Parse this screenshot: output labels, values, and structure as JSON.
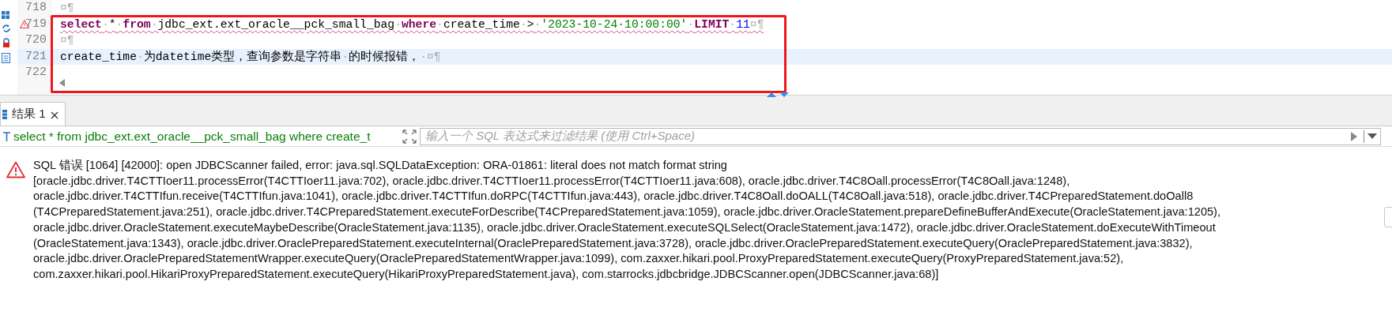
{
  "editor": {
    "lines": [
      {
        "number": "718",
        "warning": false,
        "current": false,
        "squiggle": false,
        "tokens": [
          {
            "text": "¤¶",
            "kind": "mark"
          }
        ]
      },
      {
        "number": "719",
        "warning": true,
        "current": false,
        "squiggle": true,
        "tokens": [
          {
            "text": "select",
            "kind": "keyword"
          },
          {
            "text": "·",
            "kind": "mark"
          },
          {
            "text": "*",
            "kind": "plain"
          },
          {
            "text": "·",
            "kind": "mark"
          },
          {
            "text": "from",
            "kind": "keyword"
          },
          {
            "text": "·",
            "kind": "mark"
          },
          {
            "text": "jdbc_ext.ext_oracle__pck_small_bag",
            "kind": "plain"
          },
          {
            "text": "·",
            "kind": "mark"
          },
          {
            "text": "where",
            "kind": "keyword"
          },
          {
            "text": "·",
            "kind": "mark"
          },
          {
            "text": "create_time",
            "kind": "plain"
          },
          {
            "text": "·",
            "kind": "mark"
          },
          {
            "text": ">",
            "kind": "plain"
          },
          {
            "text": "·",
            "kind": "mark"
          },
          {
            "text": "'2023-10-24·10:00:00'",
            "kind": "string"
          },
          {
            "text": "·",
            "kind": "mark"
          },
          {
            "text": "LIMIT",
            "kind": "keyword"
          },
          {
            "text": "·",
            "kind": "mark"
          },
          {
            "text": "11",
            "kind": "number"
          },
          {
            "text": "¤¶",
            "kind": "mark"
          }
        ]
      },
      {
        "number": "720",
        "warning": false,
        "current": false,
        "squiggle": false,
        "tokens": [
          {
            "text": "¤¶",
            "kind": "mark"
          }
        ]
      },
      {
        "number": "721",
        "warning": false,
        "current": true,
        "squiggle": false,
        "tokens": [
          {
            "text": "create_time",
            "kind": "plain"
          },
          {
            "text": "·",
            "kind": "mark"
          },
          {
            "text": "为datetime类型，查询参数是字符串",
            "kind": "plain"
          },
          {
            "text": "·",
            "kind": "mark"
          },
          {
            "text": "的时候报错，",
            "kind": "plain"
          },
          {
            "text": "·¤¶",
            "kind": "mark"
          }
        ]
      },
      {
        "number": "722",
        "warning": false,
        "current": false,
        "squiggle": false
      }
    ]
  },
  "results": {
    "tabs": [
      {
        "label": "结果 1",
        "selected": true,
        "closable": true
      }
    ],
    "query": "select * from jdbc_ext.ext_oracle__pck_small_bag where create_t",
    "filter": {
      "placeholder": "输入一个 SQL 表达式来过滤结果 (使用 Ctrl+Space)"
    },
    "error_lines": [
      "SQL 错误 [1064] [42000]: open JDBCScanner failed, error: java.sql.SQLDataException: ORA-01861: literal does not match format string",
      "[oracle.jdbc.driver.T4CTTIoer11.processError(T4CTTIoer11.java:702), oracle.jdbc.driver.T4CTTIoer11.processError(T4CTTIoer11.java:608), oracle.jdbc.driver.T4C8Oall.processError(T4C8Oall.java:1248),",
      "oracle.jdbc.driver.T4CTTIfun.receive(T4CTTIfun.java:1041), oracle.jdbc.driver.T4CTTIfun.doRPC(T4CTTIfun.java:443), oracle.jdbc.driver.T4C8Oall.doOALL(T4C8Oall.java:518), oracle.jdbc.driver.T4CPreparedStatement.doOall8",
      "(T4CPreparedStatement.java:251), oracle.jdbc.driver.T4CPreparedStatement.executeForDescribe(T4CPreparedStatement.java:1059), oracle.jdbc.driver.OracleStatement.prepareDefineBufferAndExecute(OracleStatement.java:1205),",
      "oracle.jdbc.driver.OracleStatement.executeMaybeDescribe(OracleStatement.java:1135), oracle.jdbc.driver.OracleStatement.executeSQLSelect(OracleStatement.java:1472), oracle.jdbc.driver.OracleStatement.doExecuteWithTimeout",
      "(OracleStatement.java:1343), oracle.jdbc.driver.OraclePreparedStatement.executeInternal(OraclePreparedStatement.java:3728), oracle.jdbc.driver.OraclePreparedStatement.executeQuery(OraclePreparedStatement.java:3832),",
      "oracle.jdbc.driver.OraclePreparedStatementWrapper.executeQuery(OraclePreparedStatementWrapper.java:1099), com.zaxxer.hikari.pool.ProxyPreparedStatement.executeQuery(ProxyPreparedStatement.java:52),",
      "com.zaxxer.hikari.pool.HikariProxyPreparedStatement.executeQuery(HikariProxyPreparedStatement.java), com.starrocks.jdbcbridge.JDBCScanner.open(JDBCScanner.java:68)]"
    ]
  }
}
